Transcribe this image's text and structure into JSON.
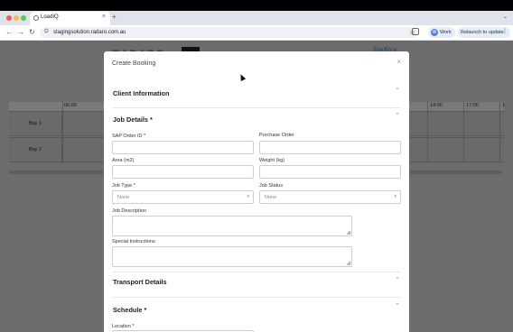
{
  "browser": {
    "tab_title": "LoadIQ",
    "tab_close": "×",
    "new_tab": "+",
    "tabs_menu": "⌄",
    "url": "stagingsolution.radaro.com.au",
    "profile_initial": "W",
    "profile_label": "Work",
    "relaunch_label": "Relaunch to update",
    "relaunch_dots": "⋮",
    "back": "←",
    "forward": "→",
    "reload": "↻",
    "site_info": "⛭",
    "bookmark": "☆"
  },
  "background": {
    "logo_left": "RADARO",
    "logo_right": "linfox",
    "times": [
      "06:00",
      "14:00",
      "17:00",
      "1"
    ],
    "bays": [
      "Bay 1",
      "Bay 2"
    ]
  },
  "modal": {
    "title": "Create Booking",
    "close": "×",
    "sections": {
      "client": {
        "title": "Client Information",
        "chevron": "⌄"
      },
      "job": {
        "title": "Job Details *",
        "chevron": "⌃"
      },
      "transport": {
        "title": "Transport Details",
        "chevron": "⌄"
      },
      "schedule": {
        "title": "Schedule *",
        "chevron": "⌃"
      }
    },
    "fields": {
      "sap_order_id": {
        "label": "SAP Order ID *",
        "value": ""
      },
      "purchase_order": {
        "label": "Purchase Order",
        "value": ""
      },
      "area": {
        "label": "Area (m2)",
        "value": ""
      },
      "weight": {
        "label": "Weight (kg)",
        "value": ""
      },
      "job_type": {
        "label": "Job Type *",
        "value": "None"
      },
      "job_status": {
        "label": "Job Status",
        "value": "None"
      },
      "job_description": {
        "label": "Job Description",
        "value": ""
      },
      "special_instructions": {
        "label": "Special Instructions",
        "value": ""
      },
      "location": {
        "label": "Location *"
      }
    }
  }
}
